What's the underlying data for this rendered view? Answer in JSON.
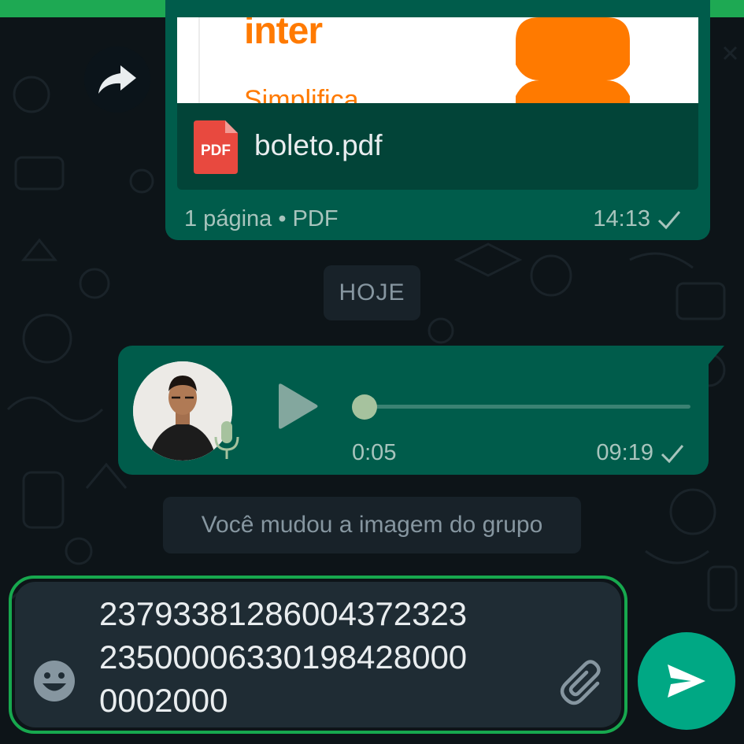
{
  "theme": {
    "background": "#0d1418",
    "outgoing_bubble": "#005c4b",
    "pill_background": "#182229",
    "composer_background": "#1f2c34",
    "send_button": "#00a884",
    "highlight_outline": "#17a84e",
    "pdf_red": "#e8493f",
    "brand_orange": "#ff7a00"
  },
  "pdf_message": {
    "preview": {
      "brand": "inter",
      "tagline": "Simplifica"
    },
    "file_icon_label": "PDF",
    "file_name": "boleto.pdf",
    "meta": "1 página • PDF",
    "time": "14:13",
    "status_icon": "single-check-icon"
  },
  "forward_button": {
    "icon": "forward-arrow-icon"
  },
  "date_separator": "HOJE",
  "voice_message": {
    "duration": "0:05",
    "time": "09:19",
    "progress": 0,
    "status_icon": "single-check-icon",
    "icons": [
      "avatar-photo",
      "microphone-icon",
      "play-icon"
    ]
  },
  "system_message": "Você mudou a imagem do grupo",
  "composer": {
    "lines": [
      "23793381286004372323",
      "23500006330198428000",
      "0002000"
    ],
    "emoji_icon": "emoji-icon",
    "attach_icon": "paperclip-icon"
  },
  "send_button": {
    "icon": "send-icon"
  }
}
